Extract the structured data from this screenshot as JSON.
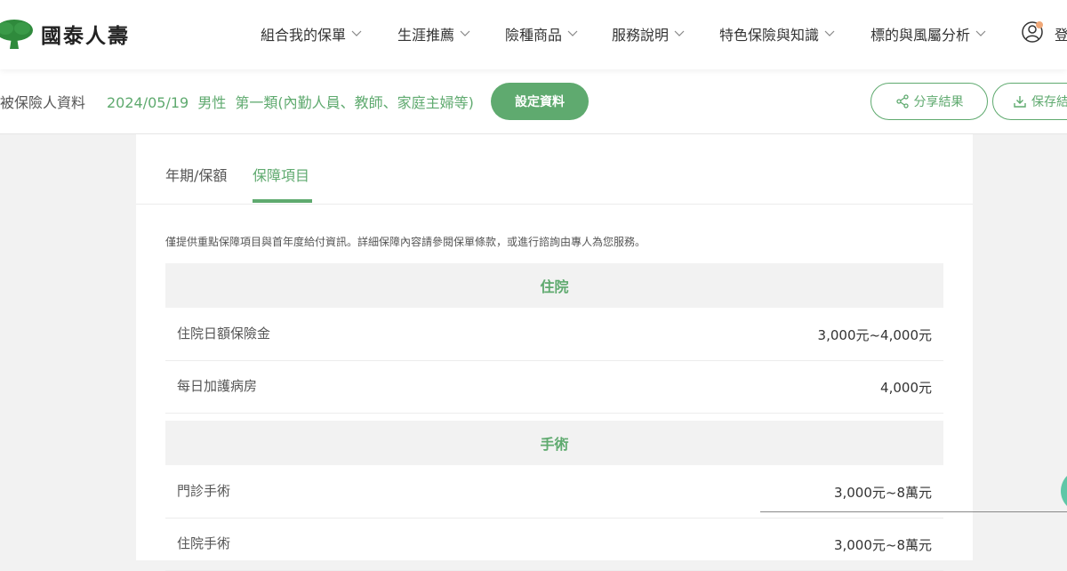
{
  "header": {
    "brand": "國泰人壽",
    "nav": [
      {
        "label": "組合我的保單"
      },
      {
        "label": "生涯推薦"
      },
      {
        "label": "險種商品"
      },
      {
        "label": "服務說明"
      },
      {
        "label": "特色保險與知識"
      },
      {
        "label": "標的與風屬分析"
      }
    ],
    "login_label": "登入"
  },
  "profile_bar": {
    "label": "被保險人資料",
    "birth_date": "2024/05/19",
    "gender": "男性",
    "occupation": "第一類(內勤人員、教師、家庭主婦等)",
    "set_button": "設定資料",
    "share_button": "分享結果",
    "save_button": "保存結果"
  },
  "tabs": [
    {
      "label": "年期/保額",
      "active": false
    },
    {
      "label": "保障項目",
      "active": true
    }
  ],
  "notice": "僅提供重點保障項目與首年度給付資訊。詳細保障內容請參閱保單條款，或進行諮詢由專人為您服務。",
  "sections": [
    {
      "title": "住院",
      "rows": [
        {
          "name": "住院日額保險金",
          "value": "3,000元~4,000元"
        },
        {
          "name": "每日加護病房",
          "value": "4,000元"
        }
      ]
    },
    {
      "title": "手術",
      "rows": [
        {
          "name": "門診手術",
          "value": "3,000元~8萬元"
        },
        {
          "name": "住院手術",
          "value": "3,000元~8萬元"
        }
      ]
    }
  ],
  "colors": {
    "brand_green": "#5faa6f",
    "logo_green": "#2f8a3c",
    "section_bg": "#f2f2f2",
    "badge_orange": "#f0a878",
    "float_teal": "#5fc7a7"
  }
}
